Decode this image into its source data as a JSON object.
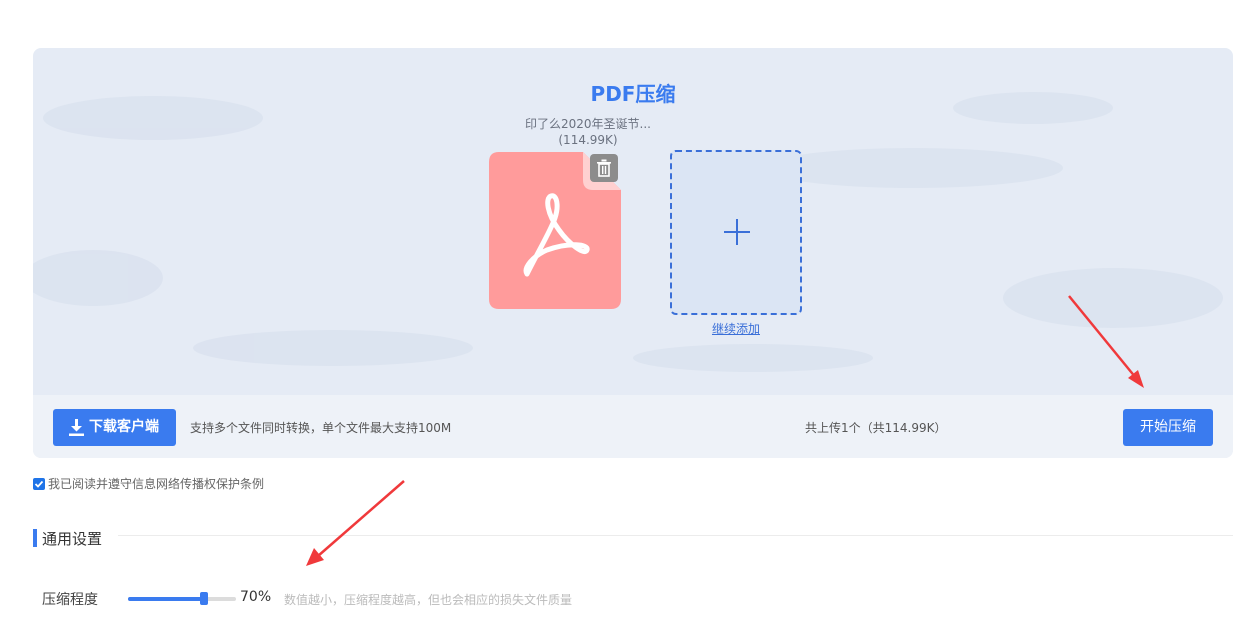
{
  "title": "PDF压缩",
  "file": {
    "name": "印了么2020年圣诞节...",
    "size": "(114.99K)",
    "icon": "pdf-file-icon",
    "color": "#ff9b9b"
  },
  "add_more": {
    "label": "继续添加",
    "icon": "plus-icon"
  },
  "toolbar": {
    "download_label": "下载客户端",
    "download_icon": "download-icon",
    "hint": "支持多个文件同时转换，单个文件最大支持100M",
    "upload_count": "共上传1个（共114.99K）",
    "start_label": "开始压缩"
  },
  "agreement": {
    "label": "我已阅读并遵守信息网络传播权保护条例",
    "checked": true
  },
  "settings": {
    "section_title": "通用设置",
    "compression_label": "压缩程度",
    "compression_value": 70,
    "compression_value_text": "70%",
    "compression_hint": "数值越小，压缩程度越高，但也会相应的损失文件质量"
  },
  "colors": {
    "accent": "#3a7bef",
    "annotation": "#f0393b"
  }
}
